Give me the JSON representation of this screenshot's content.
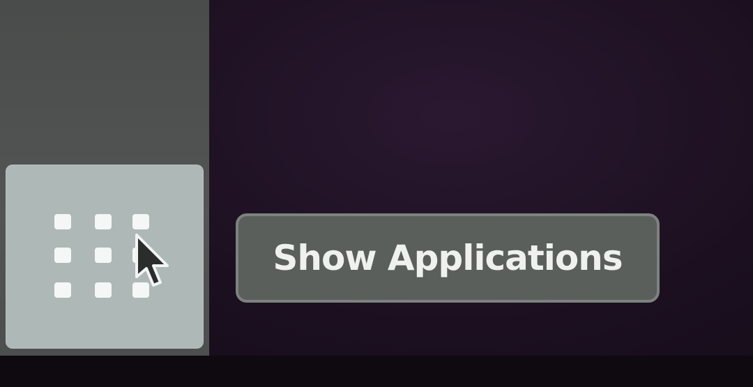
{
  "dock": {
    "show_apps_button": {
      "icon": "app-grid-icon",
      "tooltip": "Show Applications"
    }
  },
  "colors": {
    "desktop_background": "#1c1020",
    "dock_background": "#505352",
    "button_hover": "#aeb8b6",
    "tooltip_background": "#5b5f5c",
    "tooltip_text": "#eef1ee"
  },
  "pointer": {
    "icon": "mouse-pointer-icon"
  }
}
